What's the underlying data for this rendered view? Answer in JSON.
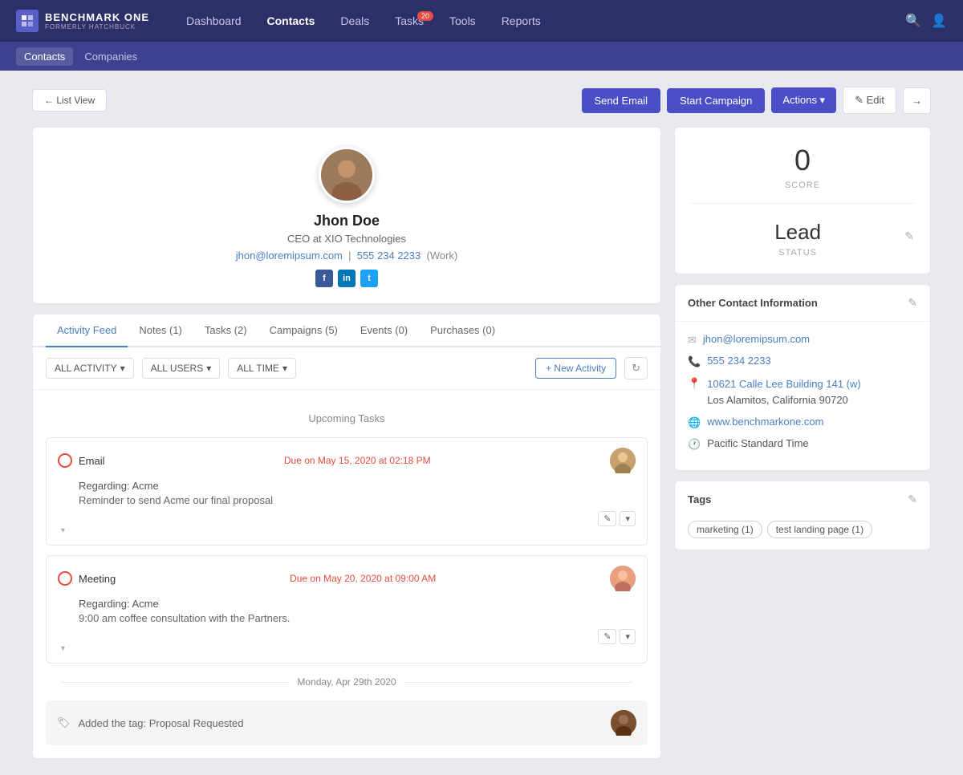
{
  "app": {
    "name": "BENCHMARK ONE",
    "sub": "FORMERLY HATCHBUCK"
  },
  "top_nav": {
    "links": [
      {
        "label": "Dashboard",
        "active": false
      },
      {
        "label": "Contacts",
        "active": true
      },
      {
        "label": "Deals",
        "active": false
      },
      {
        "label": "Tasks",
        "active": false,
        "badge": "20"
      },
      {
        "label": "Tools",
        "active": false
      },
      {
        "label": "Reports",
        "active": false
      }
    ]
  },
  "sub_nav": {
    "links": [
      {
        "label": "Contacts",
        "active": true
      },
      {
        "label": "Companies",
        "active": false
      }
    ]
  },
  "toolbar": {
    "list_view_label": "← List View",
    "send_email_label": "Send Email",
    "start_campaign_label": "Start Campaign",
    "actions_label": "Actions ▾",
    "edit_label": "✎ Edit"
  },
  "contact": {
    "name": "Jhon Doe",
    "title": "CEO at XIO Technologies",
    "email": "jhon@loremipsum.com",
    "phone": "555 234 2233",
    "phone_type": "(Work)"
  },
  "tabs": [
    {
      "label": "Activity Feed",
      "active": true
    },
    {
      "label": "Notes (1)",
      "active": false
    },
    {
      "label": "Tasks (2)",
      "active": false
    },
    {
      "label": "Campaigns (5)",
      "active": false
    },
    {
      "label": "Events (0)",
      "active": false
    },
    {
      "label": "Purchases (0)",
      "active": false
    }
  ],
  "filters": {
    "activity": "ALL ACTIVITY",
    "users": "ALL USERS",
    "time": "ALL TIME",
    "new_activity": "+ New Activity"
  },
  "activity": {
    "upcoming_tasks_label": "Upcoming Tasks",
    "tasks": [
      {
        "type": "Email",
        "due": "Due on May 15, 2020 at 02:18 PM",
        "regarding": "Regarding: Acme",
        "description": "Reminder to send Acme our final proposal"
      },
      {
        "type": "Meeting",
        "due": "Due on May 20, 2020 at 09:00 AM",
        "regarding": "Regarding: Acme",
        "description": "9:00 am coffee consultation with the Partners."
      }
    ],
    "date_label": "Monday, Apr 29th 2020",
    "tag_activity": "Added the tag: Proposal Requested"
  },
  "score": {
    "value": "0",
    "label": "SCORE"
  },
  "status": {
    "value": "Lead",
    "label": "STATUS"
  },
  "contact_info": {
    "section_title": "Other Contact Information",
    "email": "jhon@loremipsum.com",
    "phone": "555 234 2233",
    "address_line1": "10621 Calle Lee Building 141 (w)",
    "address_line2": "Los Alamitos, California 90720",
    "website": "www.benchmarkone.com",
    "timezone": "Pacific Standard Time"
  },
  "tags": {
    "section_title": "Tags",
    "items": [
      {
        "label": "marketing (1)"
      },
      {
        "label": "test landing page (1)"
      }
    ]
  }
}
